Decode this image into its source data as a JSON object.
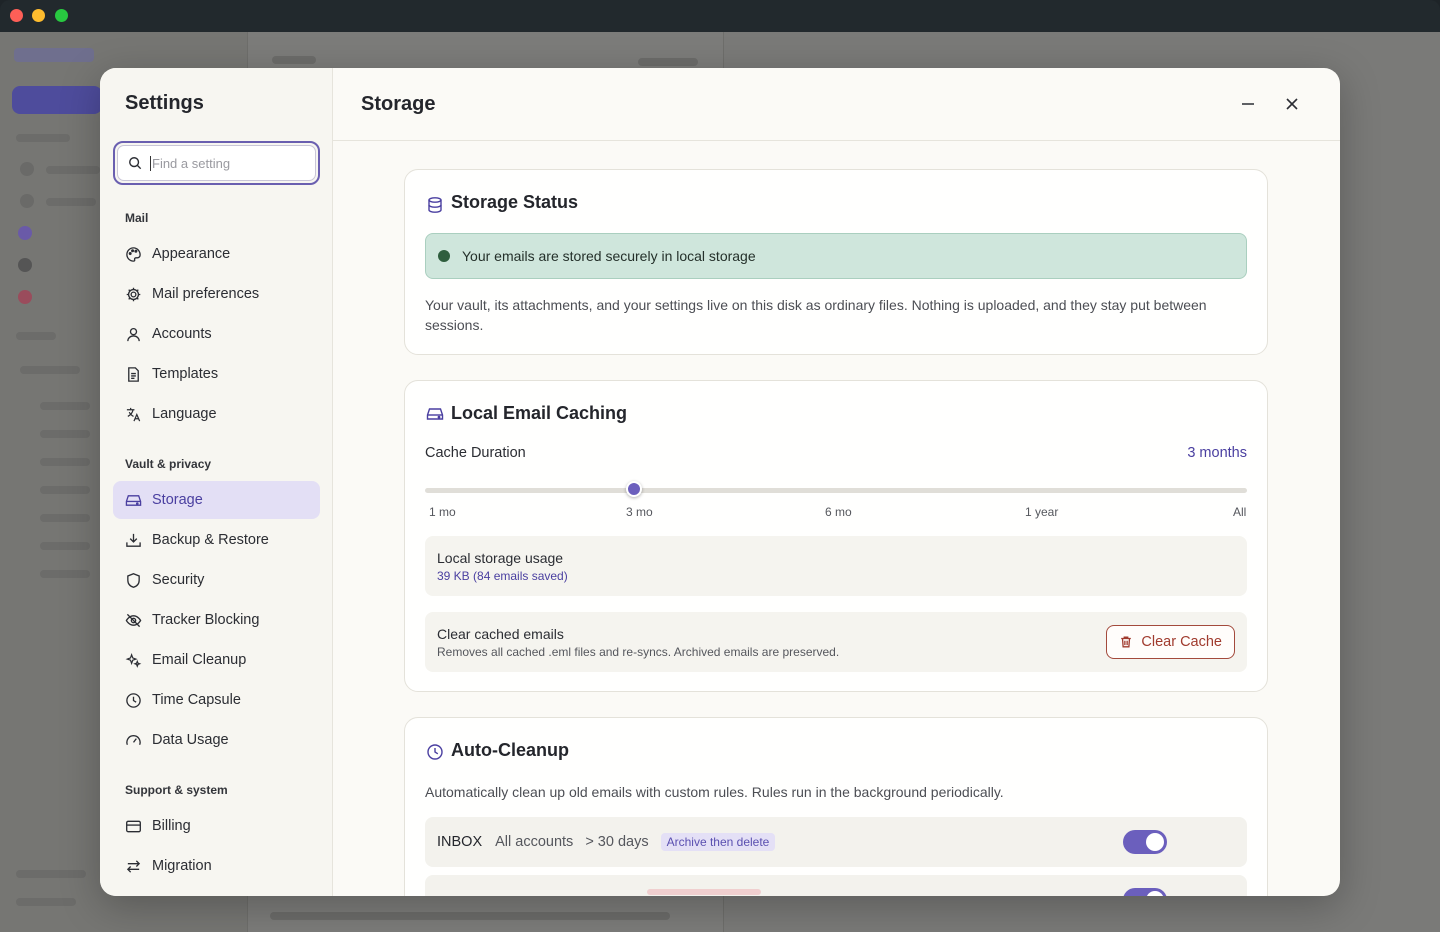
{
  "window": {
    "controls": [
      "close",
      "minimize",
      "zoom"
    ]
  },
  "settings": {
    "title": "Settings",
    "search_placeholder": "Find a setting",
    "groups": [
      {
        "label": "Mail",
        "items": [
          {
            "label": "Appearance",
            "icon": "palette-icon"
          },
          {
            "label": "Mail preferences",
            "icon": "gear-icon"
          },
          {
            "label": "Accounts",
            "icon": "user-icon"
          },
          {
            "label": "Templates",
            "icon": "document-icon"
          },
          {
            "label": "Language",
            "icon": "translate-icon"
          }
        ]
      },
      {
        "label": "Vault & privacy",
        "items": [
          {
            "label": "Storage",
            "icon": "drive-icon",
            "active": true
          },
          {
            "label": "Backup & Restore",
            "icon": "download-tray-icon"
          },
          {
            "label": "Security",
            "icon": "shield-icon"
          },
          {
            "label": "Tracker Blocking",
            "icon": "eye-off-icon"
          },
          {
            "label": "Email Cleanup",
            "icon": "sparkles-icon"
          },
          {
            "label": "Time Capsule",
            "icon": "clock-icon"
          },
          {
            "label": "Data Usage",
            "icon": "gauge-icon"
          }
        ]
      },
      {
        "label": "Support & system",
        "items": [
          {
            "label": "Billing",
            "icon": "credit-card-icon"
          },
          {
            "label": "Migration",
            "icon": "arrows-swap-icon"
          }
        ]
      }
    ]
  },
  "page": {
    "title": "Storage",
    "minimize_icon": "minus-icon",
    "close_icon": "close-icon"
  },
  "storage_status": {
    "title": "Storage Status",
    "banner_text": "Your emails are stored securely in local storage",
    "description": "Your vault, its attachments, and your settings live on this disk as ordinary files. Nothing is uploaded, and they stay put between sessions."
  },
  "caching": {
    "title": "Local Email Caching",
    "duration_label": "Cache Duration",
    "duration_value": "3 months",
    "ticks": [
      "1 mo",
      "3 mo",
      "6 mo",
      "1 year",
      "All"
    ],
    "selected_index": 1,
    "usage_title": "Local storage usage",
    "usage_value": "39 KB (84 emails saved)",
    "clear_title": "Clear cached emails",
    "clear_note": "Removes all cached .eml files and re-syncs. Archived emails are preserved.",
    "clear_button": "Clear Cache"
  },
  "auto_cleanup": {
    "title": "Auto-Cleanup",
    "description": "Automatically clean up old emails with custom rules. Rules run in the background periodically.",
    "rules": [
      {
        "folder": "INBOX",
        "scope": "All accounts",
        "age": "> 30 days",
        "action": "Archive then delete",
        "enabled": true
      }
    ]
  },
  "colors": {
    "accent": "#6b5fbd",
    "success_bg": "#cfe6dc",
    "danger": "#a03b2e"
  }
}
